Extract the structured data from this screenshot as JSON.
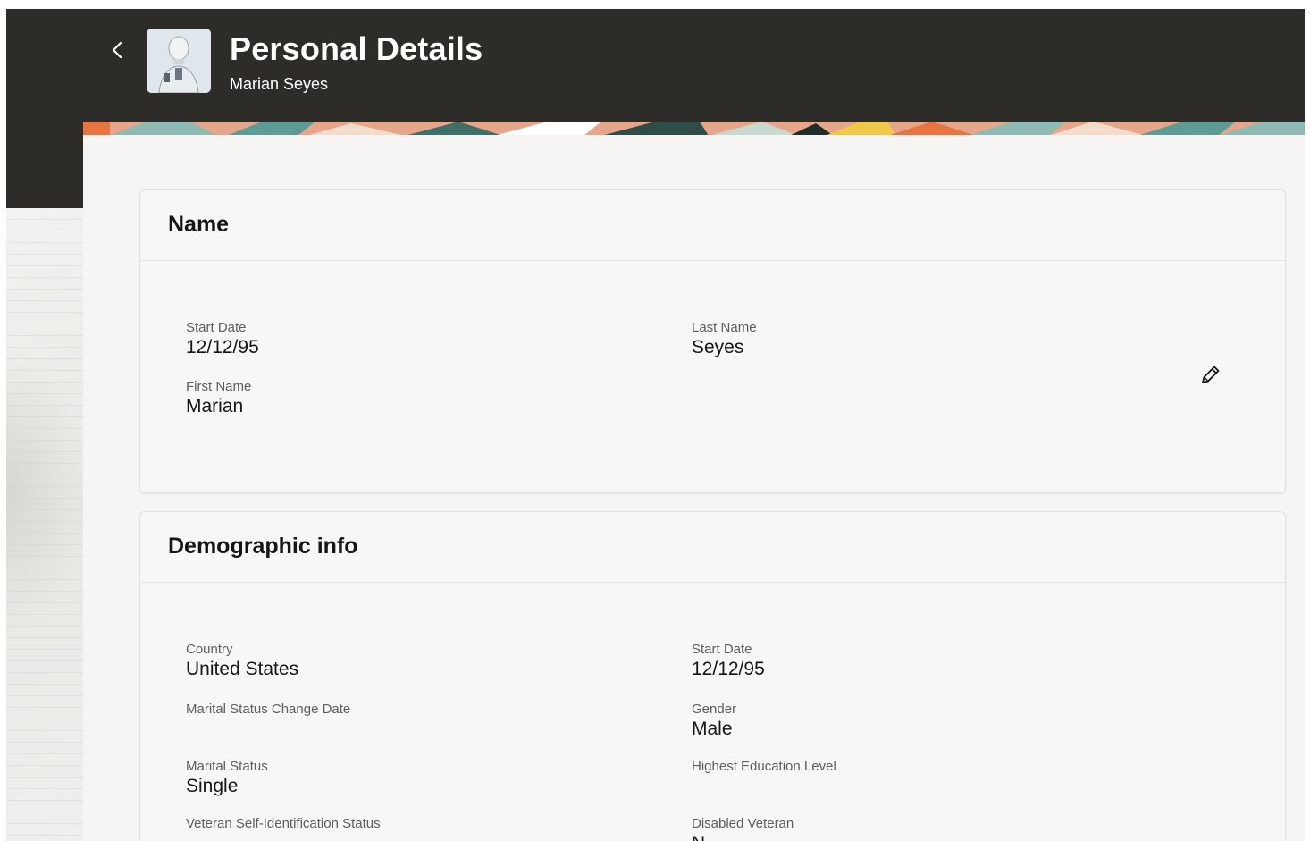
{
  "header": {
    "title": "Personal Details",
    "subtitle": "Marian Seyes",
    "back_icon": "chevron-left-icon"
  },
  "colors": {
    "header_bg": "#2d2c28",
    "content_bg": "#f6f5f4",
    "banner_orange": "#e8743f",
    "banner_teal": "#5e9b94",
    "text_primary": "#161513",
    "text_label": "#5f5d59"
  },
  "name_section": {
    "title": "Name",
    "fields": {
      "start_date": {
        "label": "Start Date",
        "value": "12/12/95"
      },
      "first_name": {
        "label": "First Name",
        "value": "Marian"
      },
      "last_name": {
        "label": "Last Name",
        "value": "Seyes"
      }
    },
    "edit_icon": "pencil-icon"
  },
  "demographic_section": {
    "title": "Demographic info",
    "fields": {
      "country": {
        "label": "Country",
        "value": "United States"
      },
      "marital_status_change_date": {
        "label": "Marital Status Change Date",
        "value": ""
      },
      "marital_status": {
        "label": "Marital Status",
        "value": "Single"
      },
      "veteran_status": {
        "label": "Veteran Self-Identification Status",
        "value": ""
      },
      "start_date": {
        "label": "Start Date",
        "value": "12/12/95"
      },
      "gender": {
        "label": "Gender",
        "value": "Male"
      },
      "highest_education": {
        "label": "Highest Education Level",
        "value": ""
      },
      "disabled_veteran": {
        "label": "Disabled Veteran",
        "value": "N"
      }
    }
  }
}
